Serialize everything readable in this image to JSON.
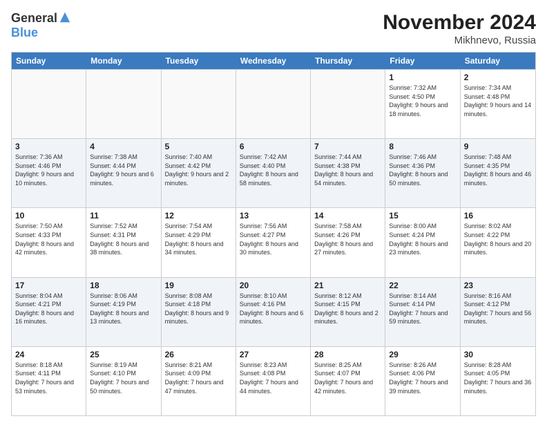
{
  "logo": {
    "general": "General",
    "blue": "Blue"
  },
  "title": "November 2024",
  "location": "Mikhnevo, Russia",
  "header_days": [
    "Sunday",
    "Monday",
    "Tuesday",
    "Wednesday",
    "Thursday",
    "Friday",
    "Saturday"
  ],
  "weeks": [
    [
      {
        "day": "",
        "info": "",
        "empty": true
      },
      {
        "day": "",
        "info": "",
        "empty": true
      },
      {
        "day": "",
        "info": "",
        "empty": true
      },
      {
        "day": "",
        "info": "",
        "empty": true
      },
      {
        "day": "",
        "info": "",
        "empty": true
      },
      {
        "day": "1",
        "info": "Sunrise: 7:32 AM\nSunset: 4:50 PM\nDaylight: 9 hours and 18 minutes."
      },
      {
        "day": "2",
        "info": "Sunrise: 7:34 AM\nSunset: 4:48 PM\nDaylight: 9 hours and 14 minutes."
      }
    ],
    [
      {
        "day": "3",
        "info": "Sunrise: 7:36 AM\nSunset: 4:46 PM\nDaylight: 9 hours and 10 minutes."
      },
      {
        "day": "4",
        "info": "Sunrise: 7:38 AM\nSunset: 4:44 PM\nDaylight: 9 hours and 6 minutes."
      },
      {
        "day": "5",
        "info": "Sunrise: 7:40 AM\nSunset: 4:42 PM\nDaylight: 9 hours and 2 minutes."
      },
      {
        "day": "6",
        "info": "Sunrise: 7:42 AM\nSunset: 4:40 PM\nDaylight: 8 hours and 58 minutes."
      },
      {
        "day": "7",
        "info": "Sunrise: 7:44 AM\nSunset: 4:38 PM\nDaylight: 8 hours and 54 minutes."
      },
      {
        "day": "8",
        "info": "Sunrise: 7:46 AM\nSunset: 4:36 PM\nDaylight: 8 hours and 50 minutes."
      },
      {
        "day": "9",
        "info": "Sunrise: 7:48 AM\nSunset: 4:35 PM\nDaylight: 8 hours and 46 minutes."
      }
    ],
    [
      {
        "day": "10",
        "info": "Sunrise: 7:50 AM\nSunset: 4:33 PM\nDaylight: 8 hours and 42 minutes."
      },
      {
        "day": "11",
        "info": "Sunrise: 7:52 AM\nSunset: 4:31 PM\nDaylight: 8 hours and 38 minutes."
      },
      {
        "day": "12",
        "info": "Sunrise: 7:54 AM\nSunset: 4:29 PM\nDaylight: 8 hours and 34 minutes."
      },
      {
        "day": "13",
        "info": "Sunrise: 7:56 AM\nSunset: 4:27 PM\nDaylight: 8 hours and 30 minutes."
      },
      {
        "day": "14",
        "info": "Sunrise: 7:58 AM\nSunset: 4:26 PM\nDaylight: 8 hours and 27 minutes."
      },
      {
        "day": "15",
        "info": "Sunrise: 8:00 AM\nSunset: 4:24 PM\nDaylight: 8 hours and 23 minutes."
      },
      {
        "day": "16",
        "info": "Sunrise: 8:02 AM\nSunset: 4:22 PM\nDaylight: 8 hours and 20 minutes."
      }
    ],
    [
      {
        "day": "17",
        "info": "Sunrise: 8:04 AM\nSunset: 4:21 PM\nDaylight: 8 hours and 16 minutes."
      },
      {
        "day": "18",
        "info": "Sunrise: 8:06 AM\nSunset: 4:19 PM\nDaylight: 8 hours and 13 minutes."
      },
      {
        "day": "19",
        "info": "Sunrise: 8:08 AM\nSunset: 4:18 PM\nDaylight: 8 hours and 9 minutes."
      },
      {
        "day": "20",
        "info": "Sunrise: 8:10 AM\nSunset: 4:16 PM\nDaylight: 8 hours and 6 minutes."
      },
      {
        "day": "21",
        "info": "Sunrise: 8:12 AM\nSunset: 4:15 PM\nDaylight: 8 hours and 2 minutes."
      },
      {
        "day": "22",
        "info": "Sunrise: 8:14 AM\nSunset: 4:14 PM\nDaylight: 7 hours and 59 minutes."
      },
      {
        "day": "23",
        "info": "Sunrise: 8:16 AM\nSunset: 4:12 PM\nDaylight: 7 hours and 56 minutes."
      }
    ],
    [
      {
        "day": "24",
        "info": "Sunrise: 8:18 AM\nSunset: 4:11 PM\nDaylight: 7 hours and 53 minutes."
      },
      {
        "day": "25",
        "info": "Sunrise: 8:19 AM\nSunset: 4:10 PM\nDaylight: 7 hours and 50 minutes."
      },
      {
        "day": "26",
        "info": "Sunrise: 8:21 AM\nSunset: 4:09 PM\nDaylight: 7 hours and 47 minutes."
      },
      {
        "day": "27",
        "info": "Sunrise: 8:23 AM\nSunset: 4:08 PM\nDaylight: 7 hours and 44 minutes."
      },
      {
        "day": "28",
        "info": "Sunrise: 8:25 AM\nSunset: 4:07 PM\nDaylight: 7 hours and 42 minutes."
      },
      {
        "day": "29",
        "info": "Sunrise: 8:26 AM\nSunset: 4:06 PM\nDaylight: 7 hours and 39 minutes."
      },
      {
        "day": "30",
        "info": "Sunrise: 8:28 AM\nSunset: 4:05 PM\nDaylight: 7 hours and 36 minutes."
      }
    ]
  ]
}
